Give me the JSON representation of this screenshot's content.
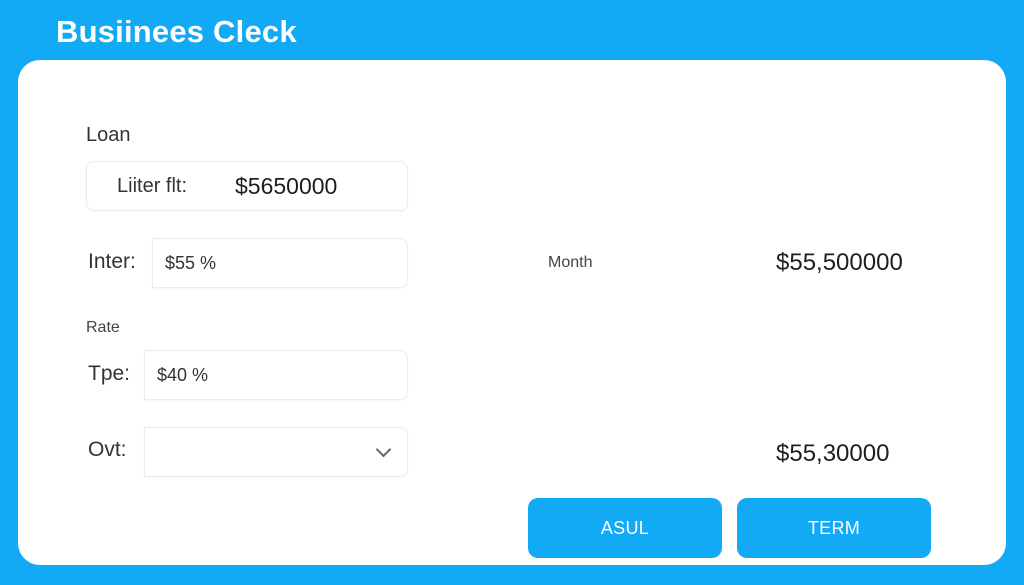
{
  "header": {
    "title": "Busiinees Cleck"
  },
  "form": {
    "loan_section_label": "Loan",
    "loan_field": {
      "label": "Liiter flt:",
      "value": "$5650000"
    },
    "interest_field": {
      "label": "Inter:",
      "value": "$55 %"
    },
    "rate_section_label": "Rate",
    "type_field": {
      "label": "Tpe:",
      "value": "$40 %"
    },
    "ovt_field": {
      "label": "Ovt:",
      "value": ""
    }
  },
  "results": {
    "month_label": "Month",
    "month_value": "$55,500000",
    "second_value": "$55,30000"
  },
  "buttons": {
    "asul_label": "ASUL",
    "term_label": "TERM"
  },
  "colors": {
    "background": "#12a9f5",
    "card": "#ffffff",
    "button": "#12a9f5"
  }
}
